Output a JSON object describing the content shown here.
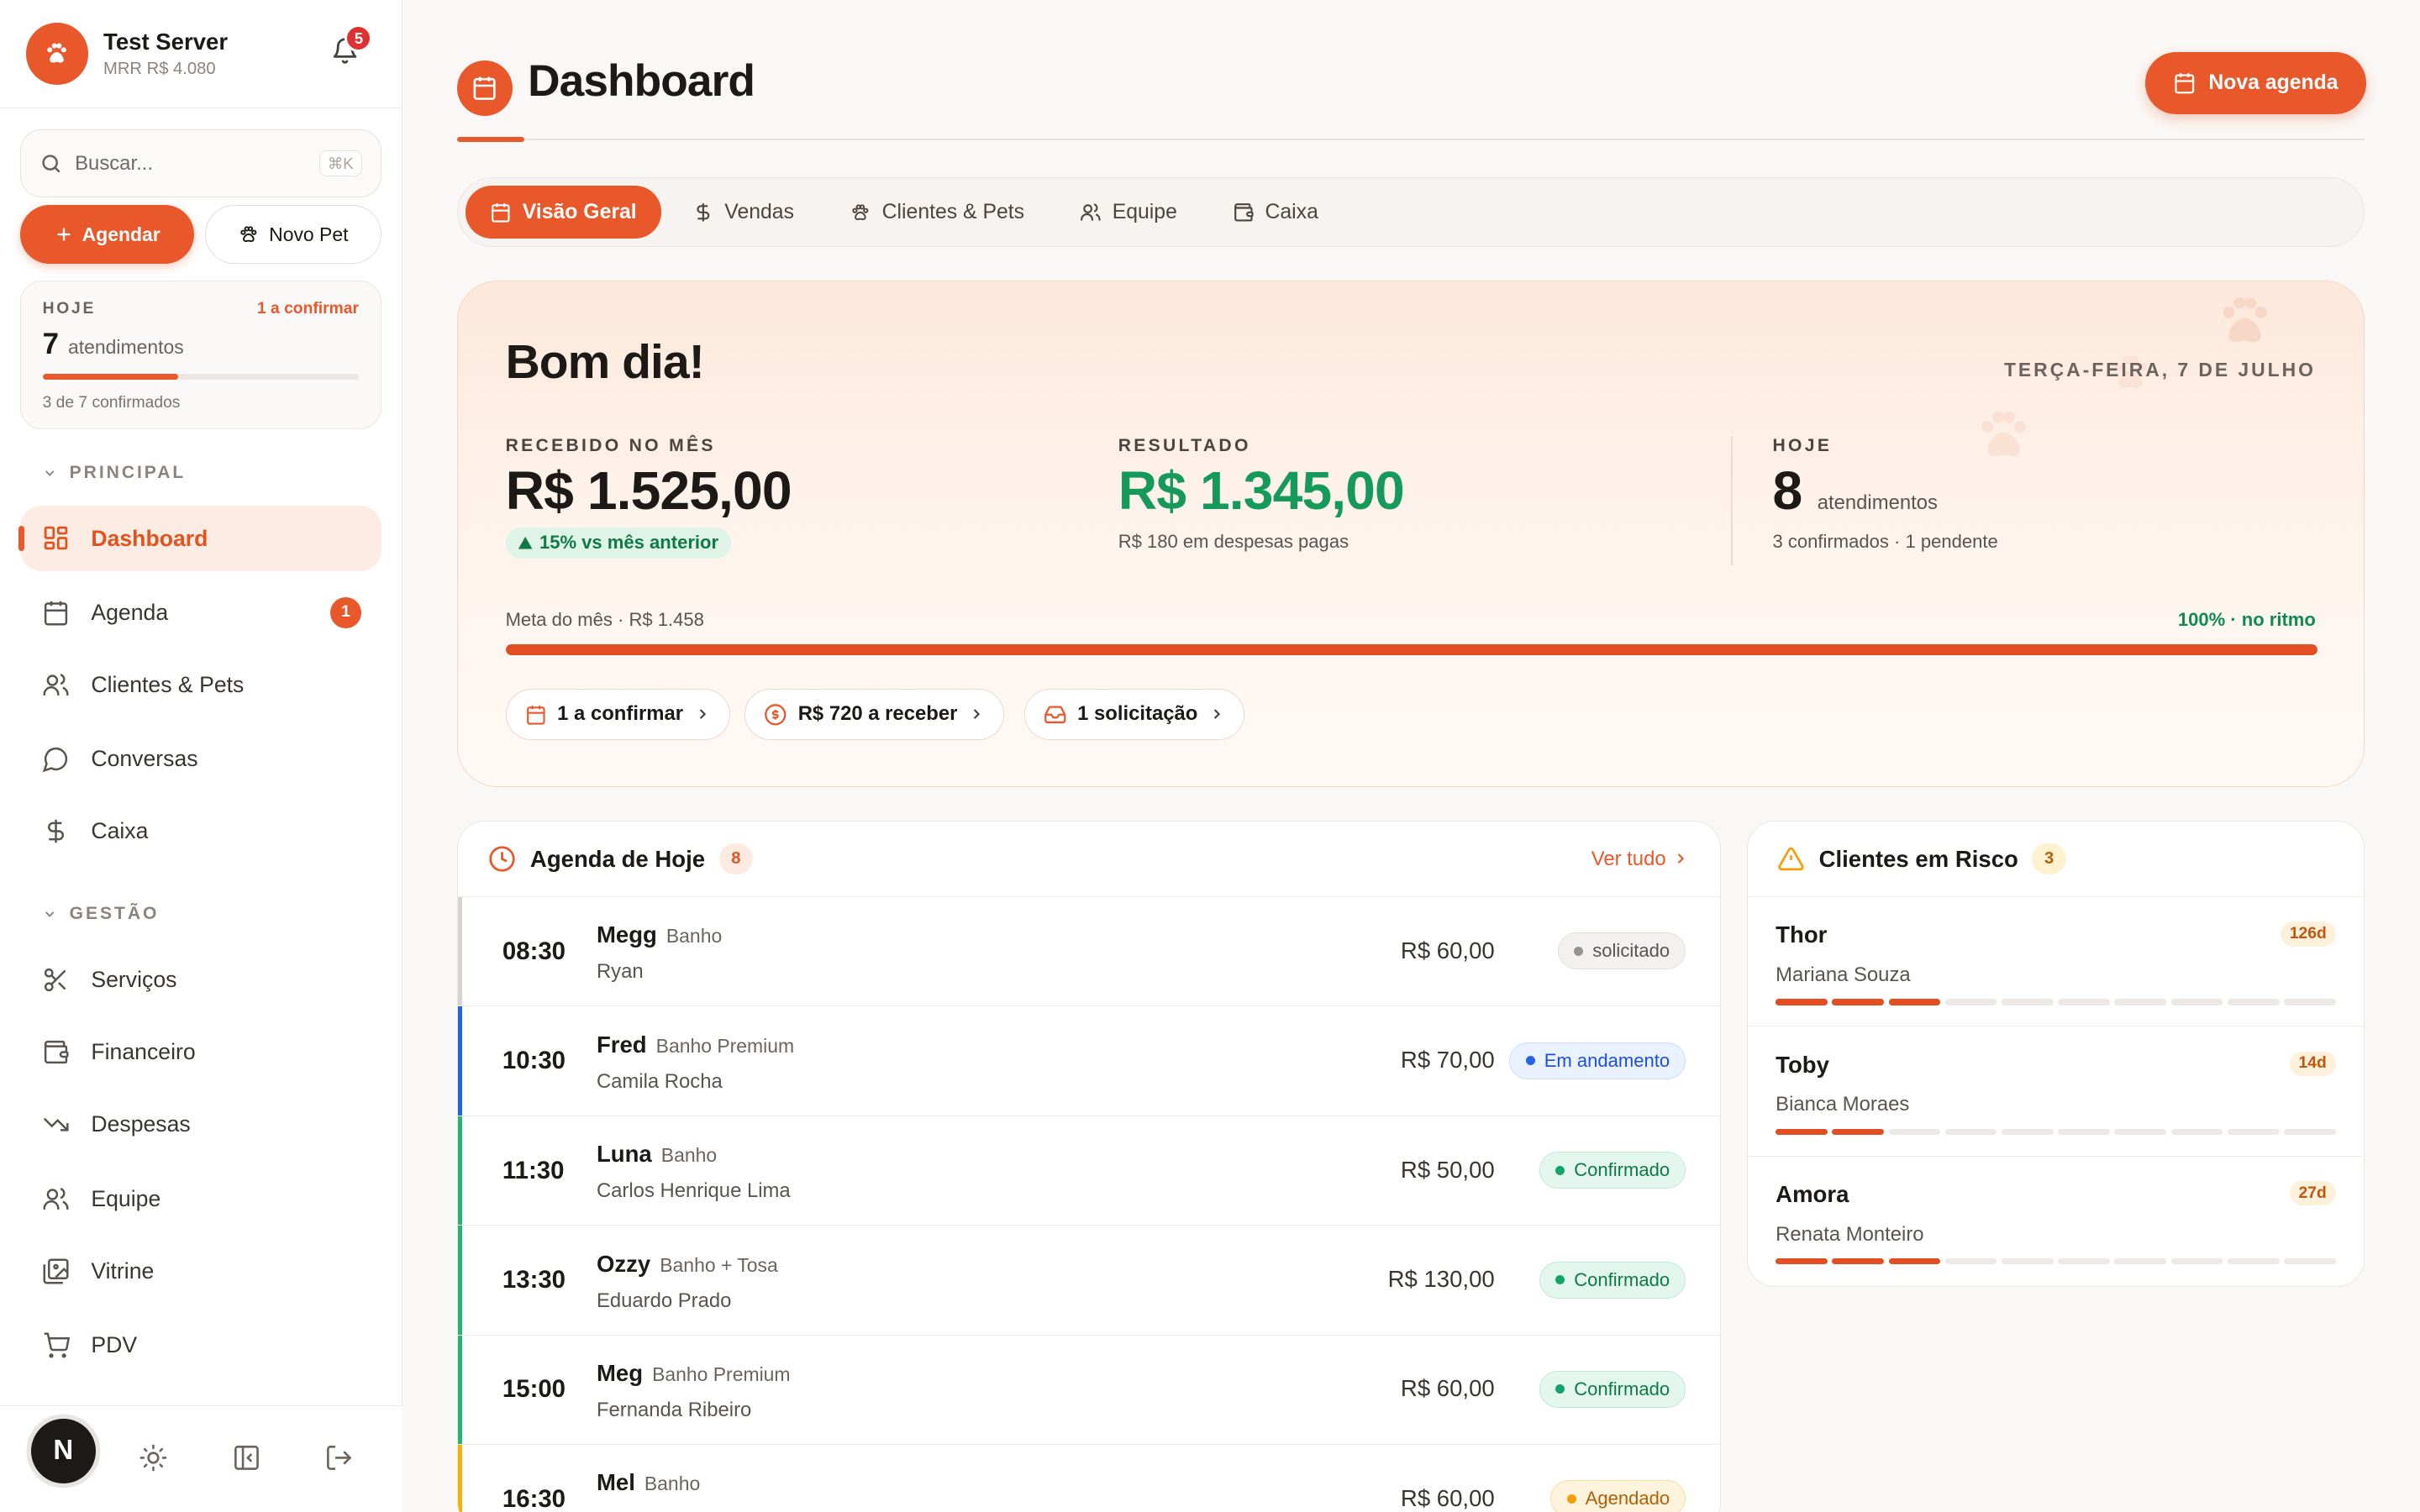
{
  "sidebar": {
    "server_name": "Test Server",
    "server_mrr": "MRR R$ 4.080",
    "notifications": "5",
    "search_placeholder": "Buscar...",
    "search_shortcut": "⌘K",
    "btn_agendar": "Agendar",
    "btn_novo_pet": "Novo Pet",
    "today": {
      "label": "HOJE",
      "to_confirm": "1 a confirmar",
      "count": "7",
      "count_label": "atendimentos",
      "progress": "3 de 7 confirmados",
      "progress_fraction": 0.43
    },
    "section_principal": "PRINCIPAL",
    "section_gestao": "GESTÃO",
    "principal": [
      {
        "label": "Dashboard",
        "icon": "grid-icon",
        "active": true
      },
      {
        "label": "Agenda",
        "icon": "calendar-icon",
        "badge": "1"
      },
      {
        "label": "Clientes & Pets",
        "icon": "users-icon"
      },
      {
        "label": "Conversas",
        "icon": "chat-icon"
      },
      {
        "label": "Caixa",
        "icon": "dollar-icon"
      }
    ],
    "gestao": [
      {
        "label": "Serviços",
        "icon": "scissors-icon"
      },
      {
        "label": "Financeiro",
        "icon": "wallet-icon"
      },
      {
        "label": "Despesas",
        "icon": "trending-down-icon"
      },
      {
        "label": "Equipe",
        "icon": "team-icon"
      },
      {
        "label": "Vitrine",
        "icon": "gallery-icon"
      },
      {
        "label": "PDV",
        "icon": "cart-icon"
      }
    ],
    "avatar_letter": "N"
  },
  "header": {
    "title": "Dashboard",
    "new_button": "Nova agenda"
  },
  "tabs": [
    "Visão Geral",
    "Vendas",
    "Clientes & Pets",
    "Equipe",
    "Caixa"
  ],
  "hero": {
    "greeting": "Bom dia!",
    "date": "TERÇA-FEIRA, 7 DE JULHO",
    "received_label": "RECEBIDO NO MÊS",
    "received_value": "R$ 1.525,00",
    "received_trend": "15% vs mês anterior",
    "result_label": "RESULTADO",
    "result_value": "R$ 1.345,00",
    "result_sub": "R$ 180 em despesas pagas",
    "today_label": "HOJE",
    "today_value": "8",
    "today_unit": "atendimentos",
    "today_sub": "3 confirmados · 1 pendente",
    "goal_label": "Meta do mês · R$ 1.458",
    "goal_status": "100% · no ritmo",
    "goal_fraction": 1.0,
    "chips": [
      "1 a confirmar",
      "R$ 720 a receber",
      "1 solicitação"
    ]
  },
  "agenda": {
    "title": "Agenda de Hoje",
    "count": "8",
    "see_all": "Ver tudo",
    "rows": [
      {
        "time": "08:30",
        "pet": "Megg",
        "service": "Banho",
        "owner": "Ryan",
        "price": "R$ 60,00",
        "status": "solicitado",
        "kind": "req"
      },
      {
        "time": "10:30",
        "pet": "Fred",
        "service": "Banho Premium",
        "owner": "Camila Rocha",
        "price": "R$ 70,00",
        "status": "Em andamento",
        "kind": "prog"
      },
      {
        "time": "11:30",
        "pet": "Luna",
        "service": "Banho",
        "owner": "Carlos Henrique Lima",
        "price": "R$ 50,00",
        "status": "Confirmado",
        "kind": "conf"
      },
      {
        "time": "13:30",
        "pet": "Ozzy",
        "service": "Banho + Tosa",
        "owner": "Eduardo Prado",
        "price": "R$ 130,00",
        "status": "Confirmado",
        "kind": "conf"
      },
      {
        "time": "15:00",
        "pet": "Meg",
        "service": "Banho Premium",
        "owner": "Fernanda Ribeiro",
        "price": "R$ 60,00",
        "status": "Confirmado",
        "kind": "conf"
      },
      {
        "time": "16:30",
        "pet": "Mel",
        "service": "Banho",
        "owner": "",
        "price": "R$ 60,00",
        "status": "Agendado",
        "kind": "sched"
      }
    ]
  },
  "risk": {
    "title": "Clientes em Risco",
    "count": "3",
    "clients": [
      {
        "pet": "Thor",
        "owner": "Mariana Souza",
        "days": "126d",
        "level": 3
      },
      {
        "pet": "Toby",
        "owner": "Bianca Moraes",
        "days": "14d",
        "level": 2
      },
      {
        "pet": "Amora",
        "owner": "Renata Monteiro",
        "days": "27d",
        "level": 3
      }
    ]
  },
  "colors": {
    "accent": "#e8582a",
    "success": "#159a5c",
    "info": "#2563eb",
    "warning": "#f59e0b"
  }
}
